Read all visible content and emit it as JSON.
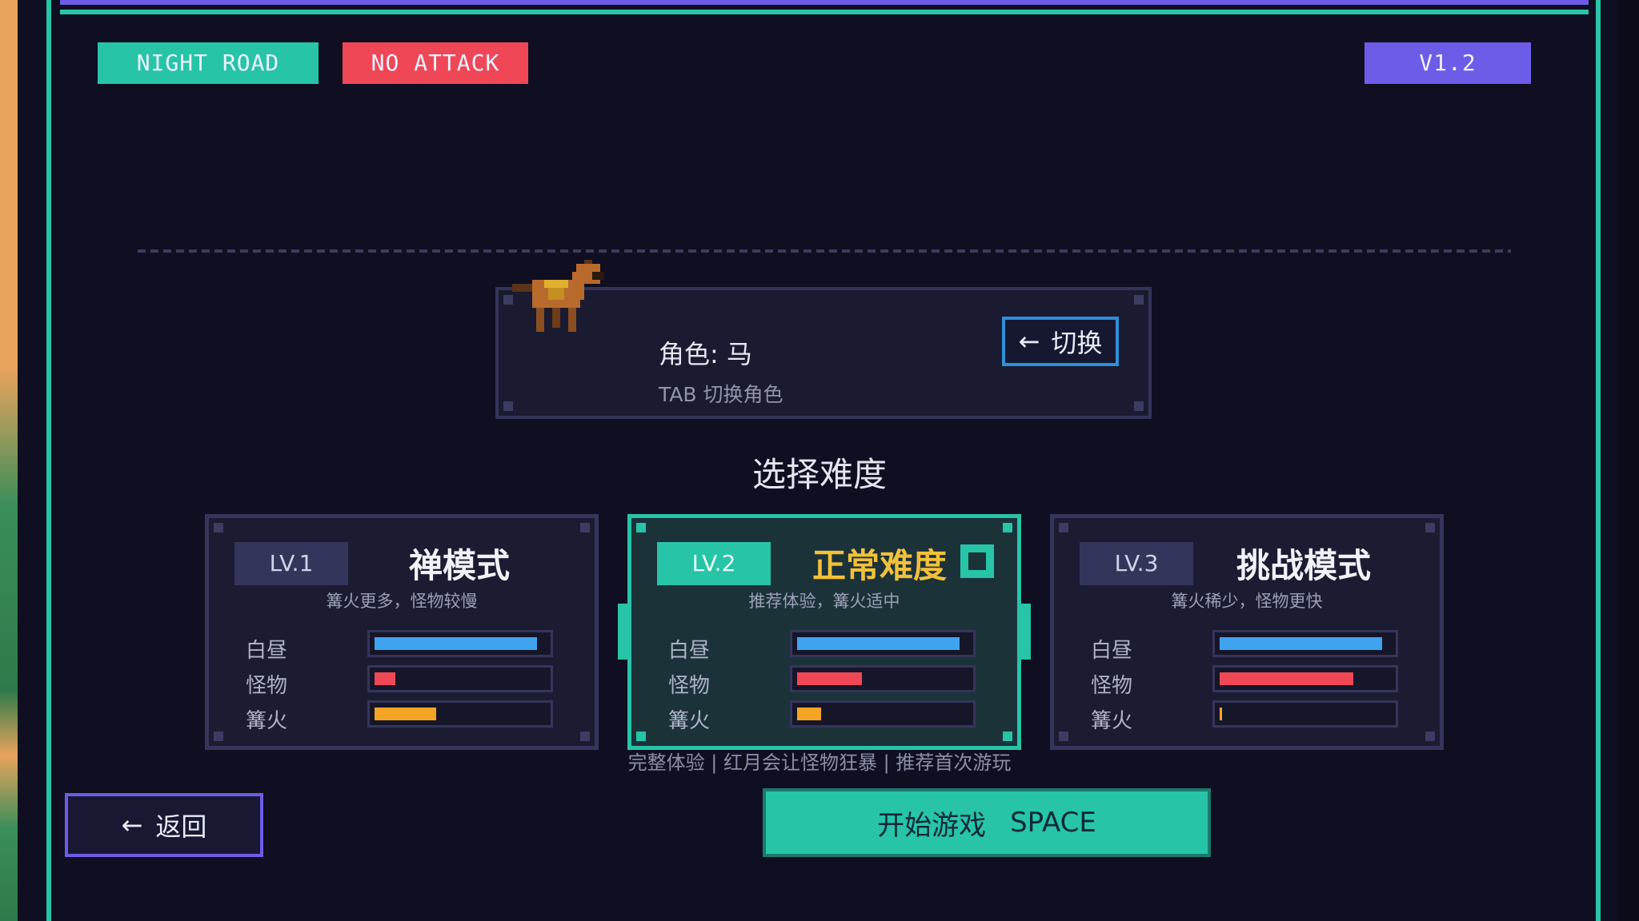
{
  "tags": {
    "night_road": "NIGHT ROAD",
    "no_attack": "NO ATTACK",
    "version": "V1.2"
  },
  "character": {
    "name_label": "角色: 马",
    "hint": "TAB 切换角色",
    "switch_arrow": "←",
    "switch_label": "切换",
    "sprite": "horse-sprite"
  },
  "section_title": "选择难度",
  "difficulties": [
    {
      "level": "LV.1",
      "name": "禅模式",
      "description": "篝火更多，怪物较慢",
      "stats": [
        {
          "label": "白昼",
          "value": 0.95,
          "color": "#3fa3f0"
        },
        {
          "label": "怪物",
          "value": 0.12,
          "color": "#ef4756"
        },
        {
          "label": "篝火",
          "value": 0.36,
          "color": "#f5a524"
        }
      ]
    },
    {
      "level": "LV.2",
      "name": "正常难度",
      "description": "推荐体验，篝火适中",
      "selected": true,
      "stats": [
        {
          "label": "白昼",
          "value": 0.95,
          "color": "#3fa3f0"
        },
        {
          "label": "怪物",
          "value": 0.38,
          "color": "#ef4756"
        },
        {
          "label": "篝火",
          "value": 0.14,
          "color": "#f5a524"
        }
      ]
    },
    {
      "level": "LV.3",
      "name": "挑战模式",
      "description": "篝火稀少，怪物更快",
      "stats": [
        {
          "label": "白昼",
          "value": 0.95,
          "color": "#3fa3f0"
        },
        {
          "label": "怪物",
          "value": 0.78,
          "color": "#ef4756"
        },
        {
          "label": "篝火",
          "value": 0.01,
          "color": "#f5a524"
        }
      ]
    }
  ],
  "footnote": "完整体验 | 红月会让怪物狂暴 | 推荐首次游玩",
  "back_button": {
    "arrow": "←",
    "label": "返回"
  },
  "start_button": {
    "label": "开始游戏",
    "key": "SPACE"
  },
  "colors": {
    "accent": "#27c4a8",
    "purple": "#6c5ce7",
    "red_tag": "#ef4756",
    "gold": "#f2c13a",
    "background": "#0f0f21"
  }
}
